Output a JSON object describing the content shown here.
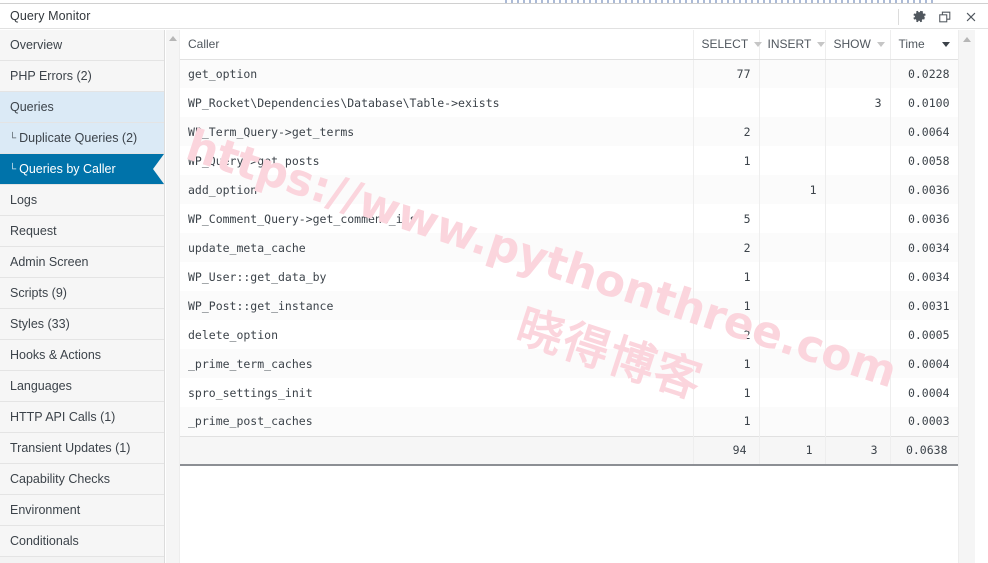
{
  "window": {
    "title": "Query Monitor",
    "controls": [
      {
        "name": "settings-button",
        "icon": "gear-icon",
        "label": "Settings"
      },
      {
        "name": "restore-button",
        "icon": "restore-icon",
        "label": "Restore"
      },
      {
        "name": "close-button",
        "icon": "close-icon",
        "label": "Close"
      }
    ]
  },
  "sidebar": {
    "items": [
      {
        "label": "Overview",
        "state": "normal",
        "sub": false
      },
      {
        "label": "PHP Errors (2)",
        "state": "normal",
        "sub": false
      },
      {
        "label": "Queries",
        "state": "open",
        "sub": false
      },
      {
        "label": "Duplicate Queries (2)",
        "state": "open",
        "sub": true,
        "prefix": "└"
      },
      {
        "label": "Queries by Caller",
        "state": "active",
        "sub": true,
        "prefix": "└"
      },
      {
        "label": "Logs",
        "state": "normal",
        "sub": false
      },
      {
        "label": "Request",
        "state": "normal",
        "sub": false
      },
      {
        "label": "Admin Screen",
        "state": "normal",
        "sub": false
      },
      {
        "label": "Scripts (9)",
        "state": "normal",
        "sub": false
      },
      {
        "label": "Styles (33)",
        "state": "normal",
        "sub": false
      },
      {
        "label": "Hooks & Actions",
        "state": "normal",
        "sub": false
      },
      {
        "label": "Languages",
        "state": "normal",
        "sub": false
      },
      {
        "label": "HTTP API Calls (1)",
        "state": "normal",
        "sub": false
      },
      {
        "label": "Transient Updates (1)",
        "state": "normal",
        "sub": false
      },
      {
        "label": "Capability Checks",
        "state": "normal",
        "sub": false
      },
      {
        "label": "Environment",
        "state": "normal",
        "sub": false
      },
      {
        "label": "Conditionals",
        "state": "normal",
        "sub": false
      }
    ]
  },
  "table": {
    "columns": [
      {
        "key": "caller",
        "label": "Caller",
        "filter": false,
        "sorted": false,
        "align": "left"
      },
      {
        "key": "select",
        "label": "SELECT",
        "filter": true,
        "sorted": false,
        "align": "right"
      },
      {
        "key": "insert",
        "label": "INSERT",
        "filter": true,
        "sorted": false,
        "align": "right"
      },
      {
        "key": "show",
        "label": "SHOW",
        "filter": true,
        "sorted": false,
        "align": "right"
      },
      {
        "key": "time",
        "label": "Time",
        "filter": true,
        "sorted": true,
        "align": "right"
      }
    ],
    "rows": [
      {
        "caller": "get_option",
        "select": "77",
        "insert": "",
        "show": "",
        "time": "0.0228"
      },
      {
        "caller": "WP_Rocket\\Dependencies\\Database\\Table->exists",
        "select": "",
        "insert": "",
        "show": "3",
        "time": "0.0100"
      },
      {
        "caller": "WP_Term_Query->get_terms",
        "select": "2",
        "insert": "",
        "show": "",
        "time": "0.0064"
      },
      {
        "caller": "WP_Query->get_posts",
        "select": "1",
        "insert": "",
        "show": "",
        "time": "0.0058"
      },
      {
        "caller": "add_option",
        "select": "",
        "insert": "1",
        "show": "",
        "time": "0.0036"
      },
      {
        "caller": "WP_Comment_Query->get_comment_ids",
        "select": "5",
        "insert": "",
        "show": "",
        "time": "0.0036"
      },
      {
        "caller": "update_meta_cache",
        "select": "2",
        "insert": "",
        "show": "",
        "time": "0.0034"
      },
      {
        "caller": "WP_User::get_data_by",
        "select": "1",
        "insert": "",
        "show": "",
        "time": "0.0034"
      },
      {
        "caller": "WP_Post::get_instance",
        "select": "1",
        "insert": "",
        "show": "",
        "time": "0.0031"
      },
      {
        "caller": "delete_option",
        "select": "2",
        "insert": "",
        "show": "",
        "time": "0.0005"
      },
      {
        "caller": "_prime_term_caches",
        "select": "1",
        "insert": "",
        "show": "",
        "time": "0.0004"
      },
      {
        "caller": "spro_settings_init",
        "select": "1",
        "insert": "",
        "show": "",
        "time": "0.0004"
      },
      {
        "caller": "_prime_post_caches",
        "select": "1",
        "insert": "",
        "show": "",
        "time": "0.0003"
      }
    ],
    "totals": {
      "caller": "",
      "select": "94",
      "insert": "1",
      "show": "3",
      "time": "0.0638"
    }
  },
  "watermarks": {
    "url": "https://www.pythonthree.com",
    "site": "晓得博客"
  },
  "colors": {
    "accent": "#0073aa",
    "accent_soft": "#dbeaf6",
    "link": "#2271b1",
    "watermark": "#fbd5dd",
    "sidebar_bg": "#f6f6f6"
  }
}
